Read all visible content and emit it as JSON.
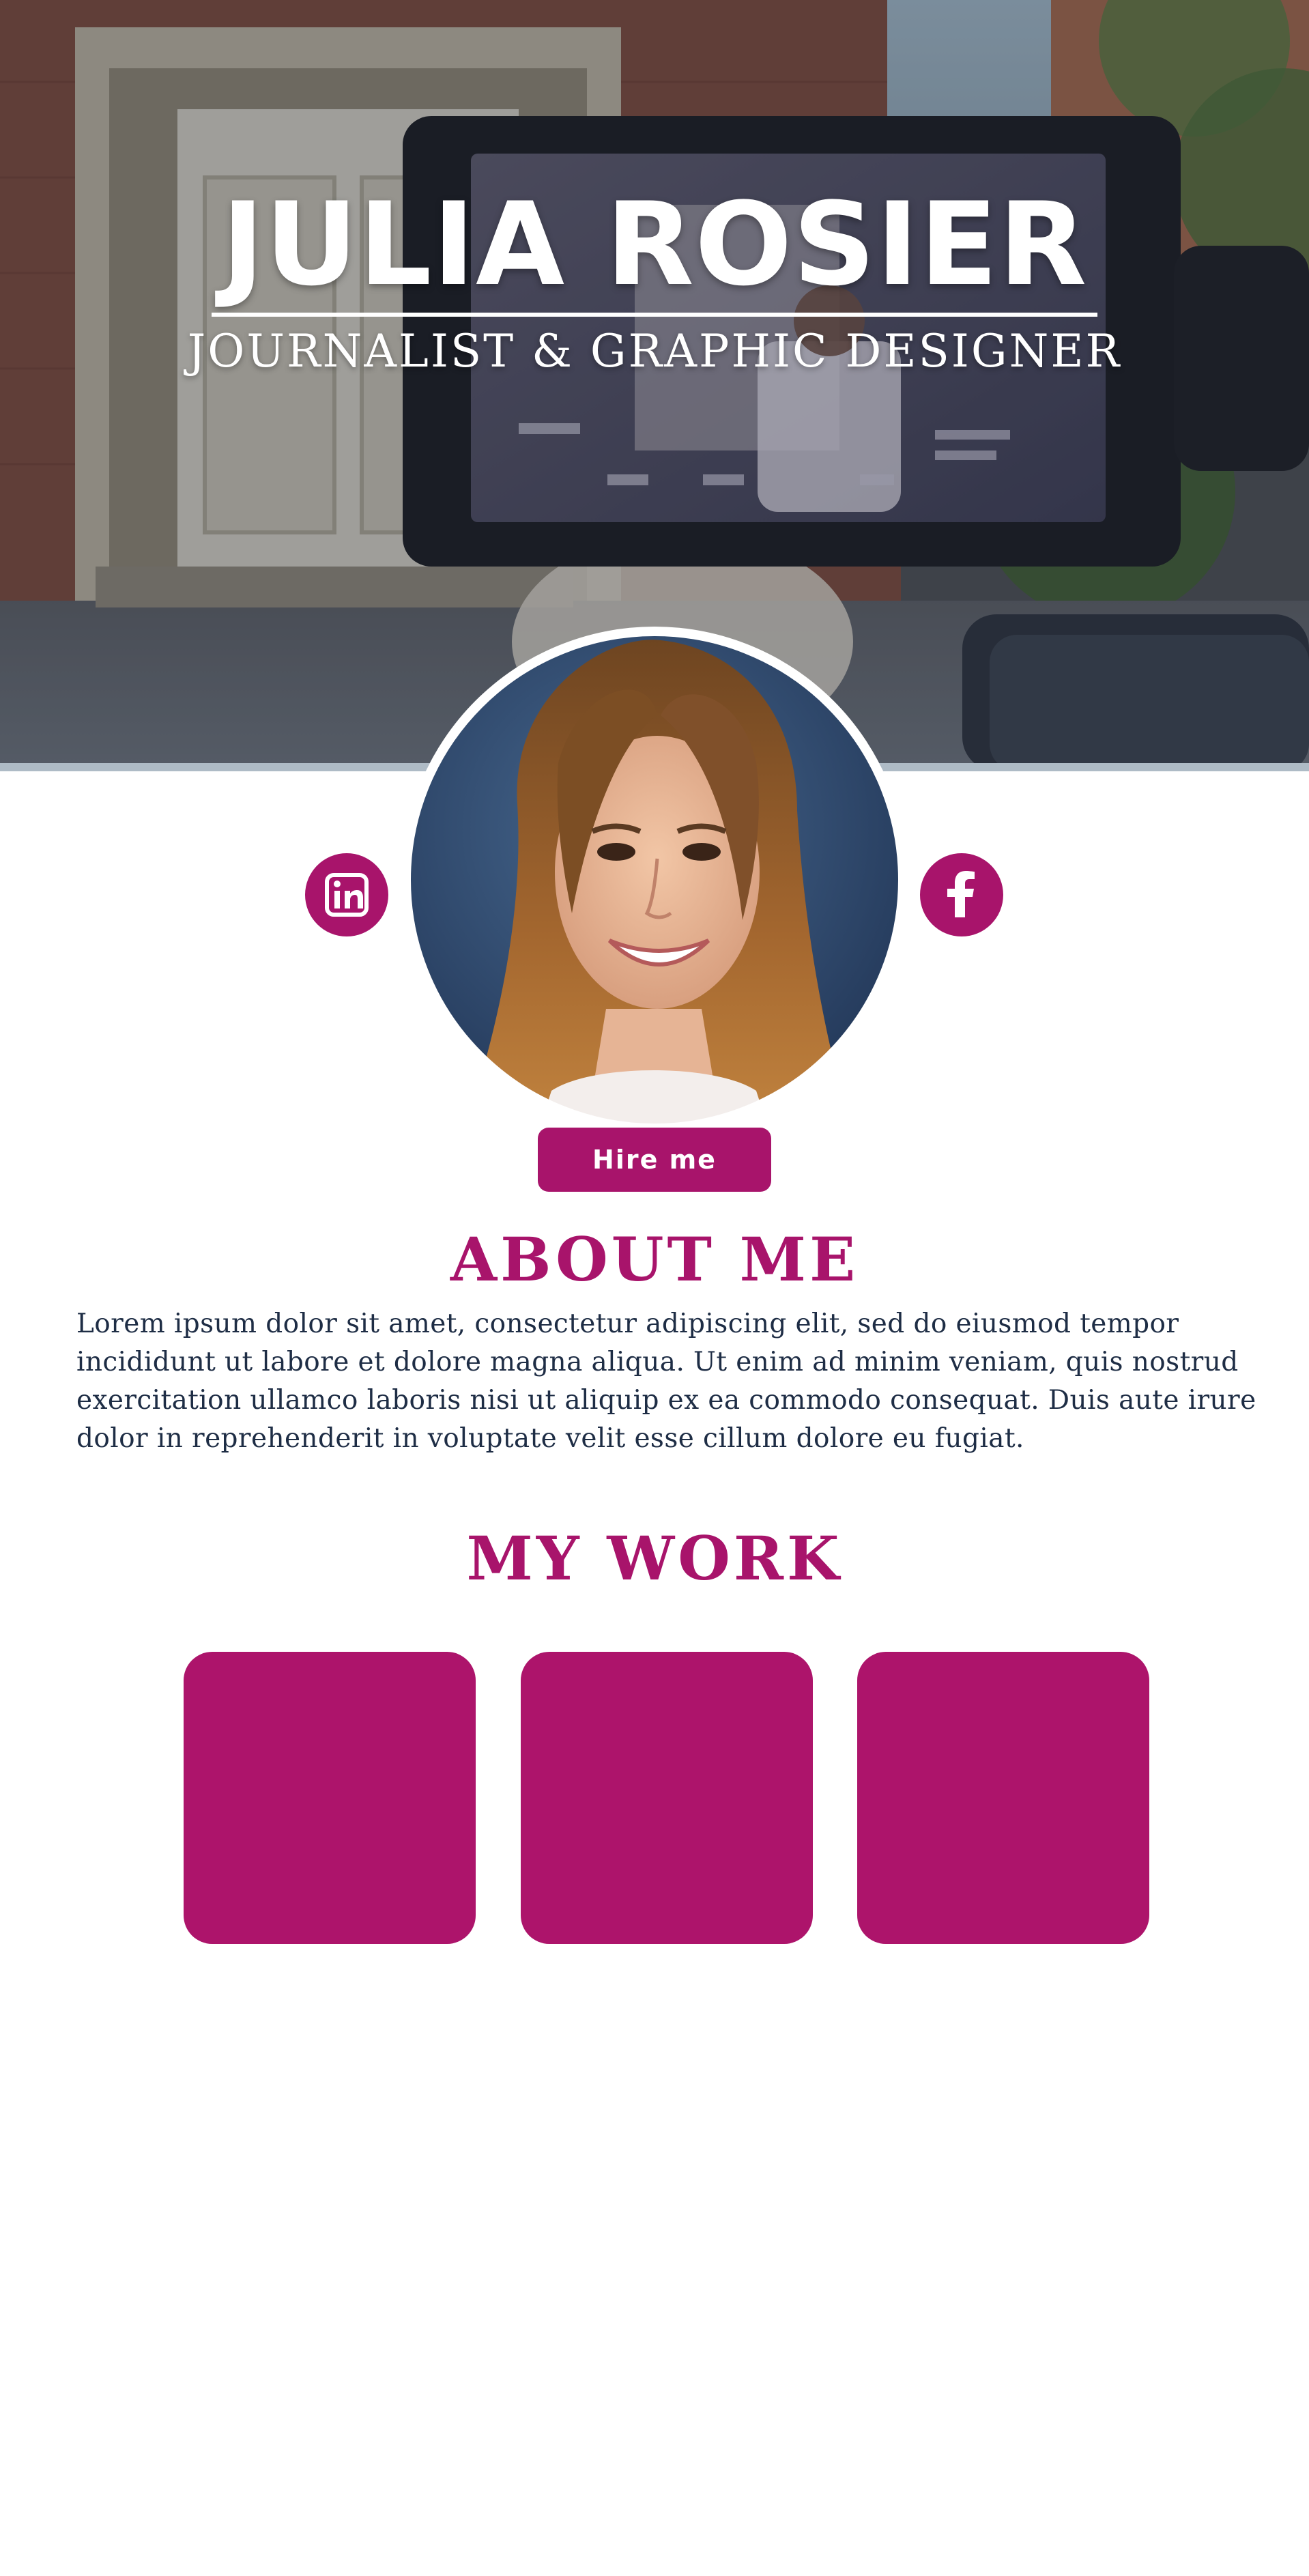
{
  "hero": {
    "name": "JULIA ROSIER",
    "subtitle": "JOURNALIST & GRAPHIC DESIGNER"
  },
  "profile": {
    "photo": "portrait-photo",
    "social": [
      {
        "network": "LinkedIn",
        "icon": "linkedin-icon",
        "glyph": "in"
      },
      {
        "network": "Facebook",
        "icon": "facebook-icon",
        "glyph": "f"
      }
    ],
    "hire_button": "Hire me"
  },
  "about": {
    "heading": "ABOUT ME",
    "body": "Lorem ipsum dolor sit amet, consectetur adipiscing elit, sed do eiusmod tempor incididunt ut labore et dolore magna aliqua. Ut enim ad minim veniam, quis nostrud exercitation ullamco laboris nisi ut aliquip ex ea commodo consequat. Duis aute irure dolor in reprehenderit in voluptate velit esse cillum dolore eu fugiat."
  },
  "work": {
    "heading": "MY WORK",
    "items": [
      {
        "id": "work-1"
      },
      {
        "id": "work-2"
      },
      {
        "id": "work-3"
      }
    ]
  },
  "colors": {
    "accent": "#a8146b",
    "text": "#1e2d45",
    "background": "#ffffff"
  }
}
